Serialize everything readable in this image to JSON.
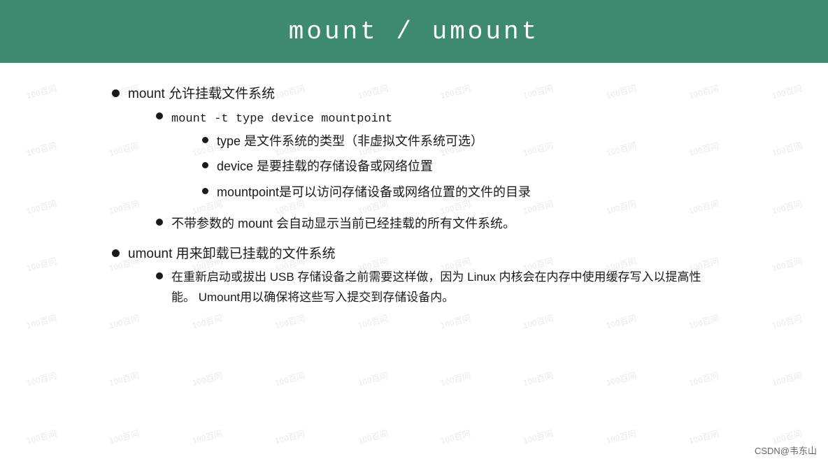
{
  "header": {
    "title": "mount  /  umount",
    "bg_color": "#3d8a6e"
  },
  "watermark": {
    "text": "100百间",
    "text2": "100百问"
  },
  "content": {
    "items": [
      {
        "level": 1,
        "text": "mount 允许挂载文件系统",
        "children": [
          {
            "level": 2,
            "text": "mount -t  type device mountpoint",
            "children": [
              {
                "level": 3,
                "text": "type 是文件系统的类型（非虚拟文件系统可选）"
              },
              {
                "level": 3,
                "text": "device 是要挂载的存储设备或网络位置"
              },
              {
                "level": 3,
                "text": "mountpoint是可以访问存储设备或网络位置的文件的目录"
              }
            ]
          },
          {
            "level": 2,
            "text": "不带参数的 mount 会自动显示当前已经挂载的所有文件系统。",
            "children": []
          }
        ]
      },
      {
        "level": 1,
        "text": "umount 用来卸载已挂载的文件系统",
        "children": [
          {
            "level": 2,
            "text": "在重新启动或拔出 USB 存储设备之前需要这样做，因为 Linux 内核会在内存中使用缓存写入以提高性能。 Umount用以确保将这些写入提交到存储设备内。",
            "children": []
          }
        ]
      }
    ]
  },
  "footer": {
    "text": "CSDN@韦东山"
  }
}
